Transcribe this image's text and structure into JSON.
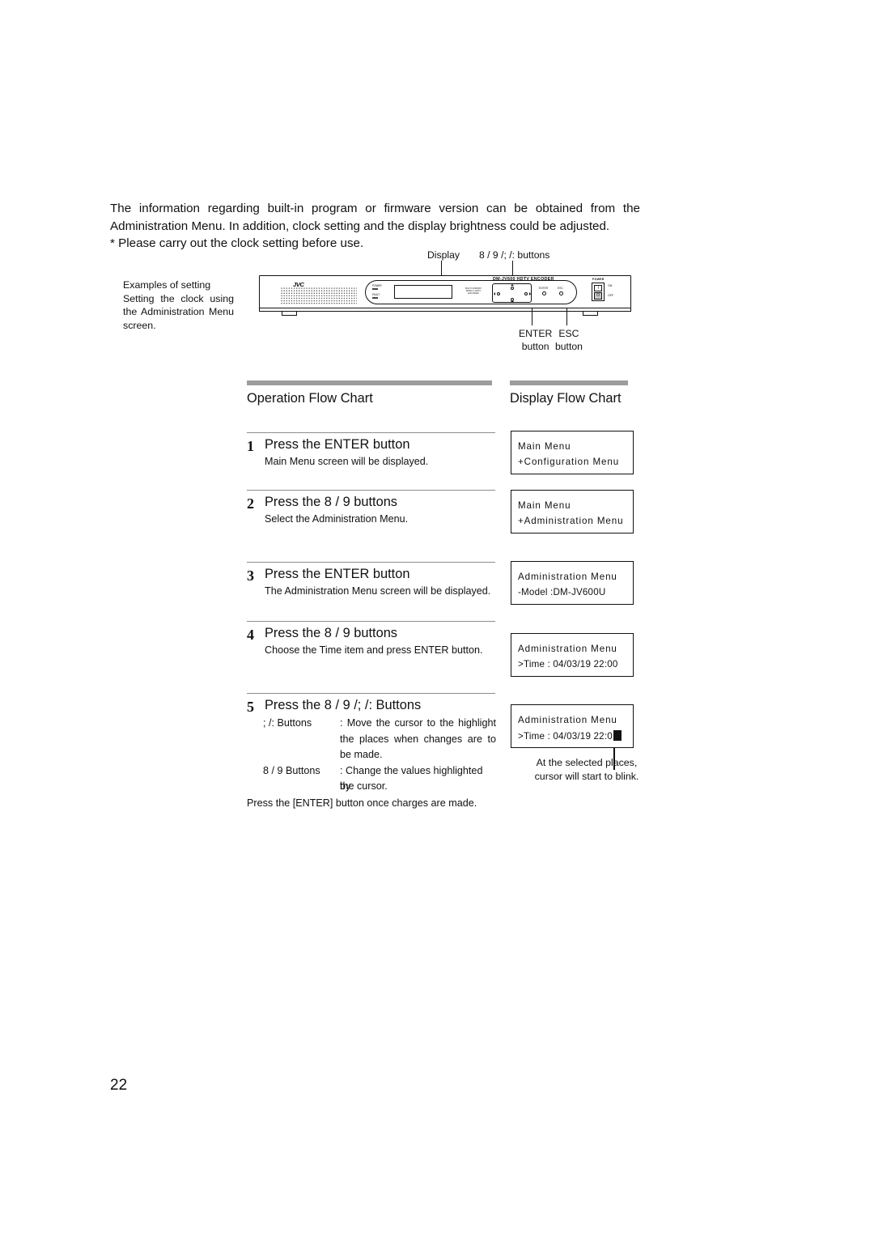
{
  "intro": {
    "line1": "The information regarding built-in program or firmware version can be obtained from the",
    "line2": "Administration Menu. In addition, clock setting and the display brightness could be adjusted.",
    "line3": "* Please carry out the clock setting before use."
  },
  "callouts": {
    "display": "Display",
    "buttons": "8 / 9 /;  /: buttons",
    "enter_label_top": "ENTER",
    "enter_label_bottom": "button",
    "esc_label_top": "ESC",
    "esc_label_bottom": "button"
  },
  "example_note": {
    "line1": "Examples of setting",
    "line2": "Setting the clock using",
    "line3": "the Administration Menu",
    "line4": "screen."
  },
  "device": {
    "brand": "JVC",
    "model_text": "DM-JV600  HDTV  ENCODER",
    "led_power": "POWER",
    "led_fault": "FAULT",
    "mini_text": "MULTI-FORMAT MPEG-2 HDTV ENCODER",
    "enter_button": "ENTER",
    "esc_button": "ESC",
    "power_word": "POWER",
    "rocker_on": "I",
    "rocker_off": "O",
    "label_on": "ON",
    "label_off": "OFF"
  },
  "flow": {
    "left_title": "Operation Flow Chart",
    "right_title": "Display Flow Chart"
  },
  "steps": [
    {
      "num": "1",
      "heading": "Press the ENTER button",
      "sub": "Main Menu screen will be displayed."
    },
    {
      "num": "2",
      "heading": "Press the 8  / 9  buttons",
      "sub": "Select the Administration Menu."
    },
    {
      "num": "3",
      "heading": "Press the ENTER button",
      "sub": "The Administration Menu screen will be displayed."
    },
    {
      "num": "4",
      "heading": "Press the 8  / 9  buttons",
      "sub": "Choose the Time item and press ENTER button."
    },
    {
      "num": "5",
      "heading": "Press the 8  / 9 /;  /:  Buttons",
      "sub": ""
    }
  ],
  "step5_detail": {
    "row1_key": ";  /:  Buttons",
    "row1_val_line1": ": Move the cursor to the highlight",
    "row1_val_line2": "the places when changes are to",
    "row1_val_line3": "be made.",
    "row2_key": "8 / 9  Buttons",
    "row2_val_line1": ": Change the values highlighted by",
    "row2_val_line2": "the cursor.",
    "final": "Press the [ENTER] button once charges are made."
  },
  "display_boxes": [
    {
      "line1": "Main  Menu",
      "line2": "+Configuration  Menu"
    },
    {
      "line1": "Main  Menu",
      "line2": "+Administration  Menu"
    },
    {
      "line1": "Administration  Menu",
      "line2": "-Model      :DM-JV600U"
    },
    {
      "line1": "Administration  Menu",
      "line2": ">Time : 04/03/19      22:00"
    },
    {
      "line1": "Administration  Menu",
      "line2": ">Time : 04/03/19     22:0"
    }
  ],
  "cursor_caption": {
    "line1": "At the selected places,",
    "line2": "cursor will start to blink."
  },
  "page_number": "22"
}
